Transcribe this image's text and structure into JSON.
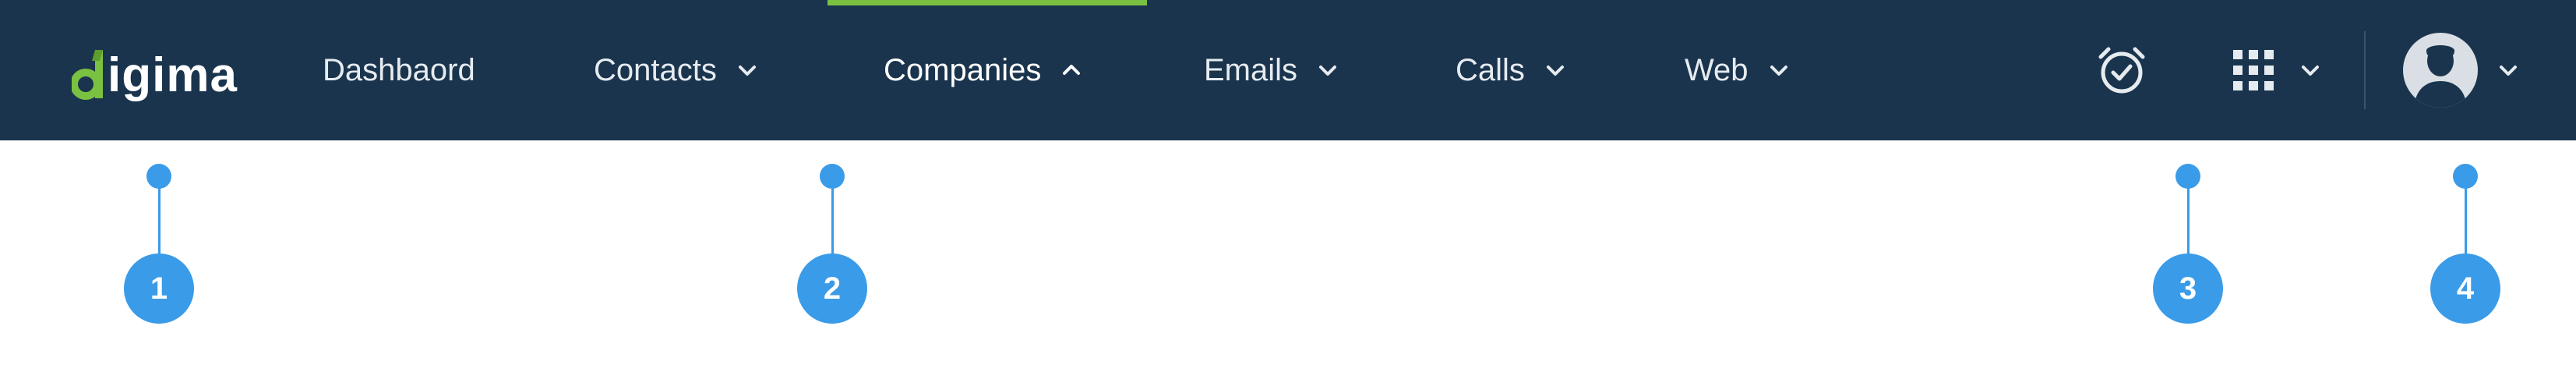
{
  "brand": {
    "logo_text": "igima",
    "logo_accent_color": "#7ac142"
  },
  "nav": {
    "items": [
      {
        "label": "Dashbaord",
        "has_dropdown": false,
        "active": false
      },
      {
        "label": "Contacts",
        "has_dropdown": true,
        "active": false
      },
      {
        "label": "Companies",
        "has_dropdown": true,
        "active": true
      },
      {
        "label": "Emails",
        "has_dropdown": true,
        "active": false
      },
      {
        "label": "Calls",
        "has_dropdown": true,
        "active": false
      },
      {
        "label": "Web",
        "has_dropdown": true,
        "active": false
      }
    ],
    "background_color": "#1a344d",
    "active_indicator_color": "#7ac142"
  },
  "toolbar": {
    "icons": [
      "alarm-clock-icon",
      "apps-grid-icon",
      "avatar"
    ]
  },
  "callouts": {
    "items": [
      {
        "number": "1"
      },
      {
        "number": "2"
      },
      {
        "number": "3"
      },
      {
        "number": "4"
      }
    ],
    "color": "#3a9be8"
  }
}
